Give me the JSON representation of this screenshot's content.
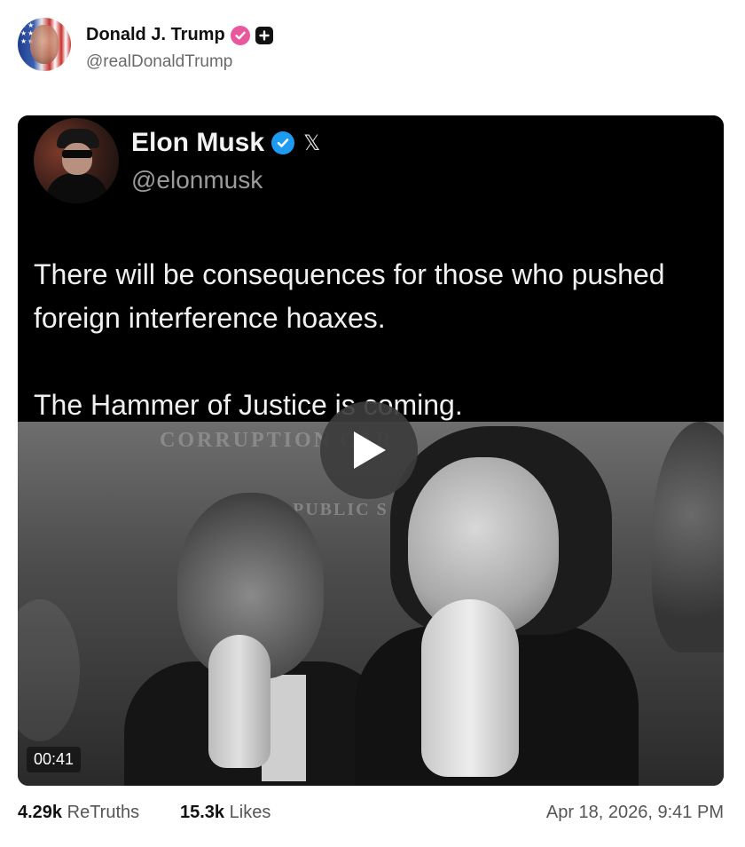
{
  "author": {
    "display_name": "Donald J. Trump",
    "handle": "@realDonaldTrump",
    "verified_badge_color": "#e9579d"
  },
  "embedded_post": {
    "display_name": "Elon Musk",
    "handle": "@elonmusk",
    "platform_icon": "x-logo-icon",
    "verified_badge_color": "#1d9bf0",
    "paragraphs": [
      "There will be consequences for those who pushed foreign interference hoaxes.",
      "The Hammer of Justice is coming."
    ]
  },
  "video": {
    "banner_text": "CORRUPTION           CAR",
    "banner_text_2": "PUBLIC S",
    "duration": "00:41"
  },
  "footer": {
    "retruths_count": "4.29k",
    "retruths_label": "ReTruths",
    "likes_count": "15.3k",
    "likes_label": "Likes",
    "timestamp": "Apr 18, 2026, 9:41 PM"
  }
}
